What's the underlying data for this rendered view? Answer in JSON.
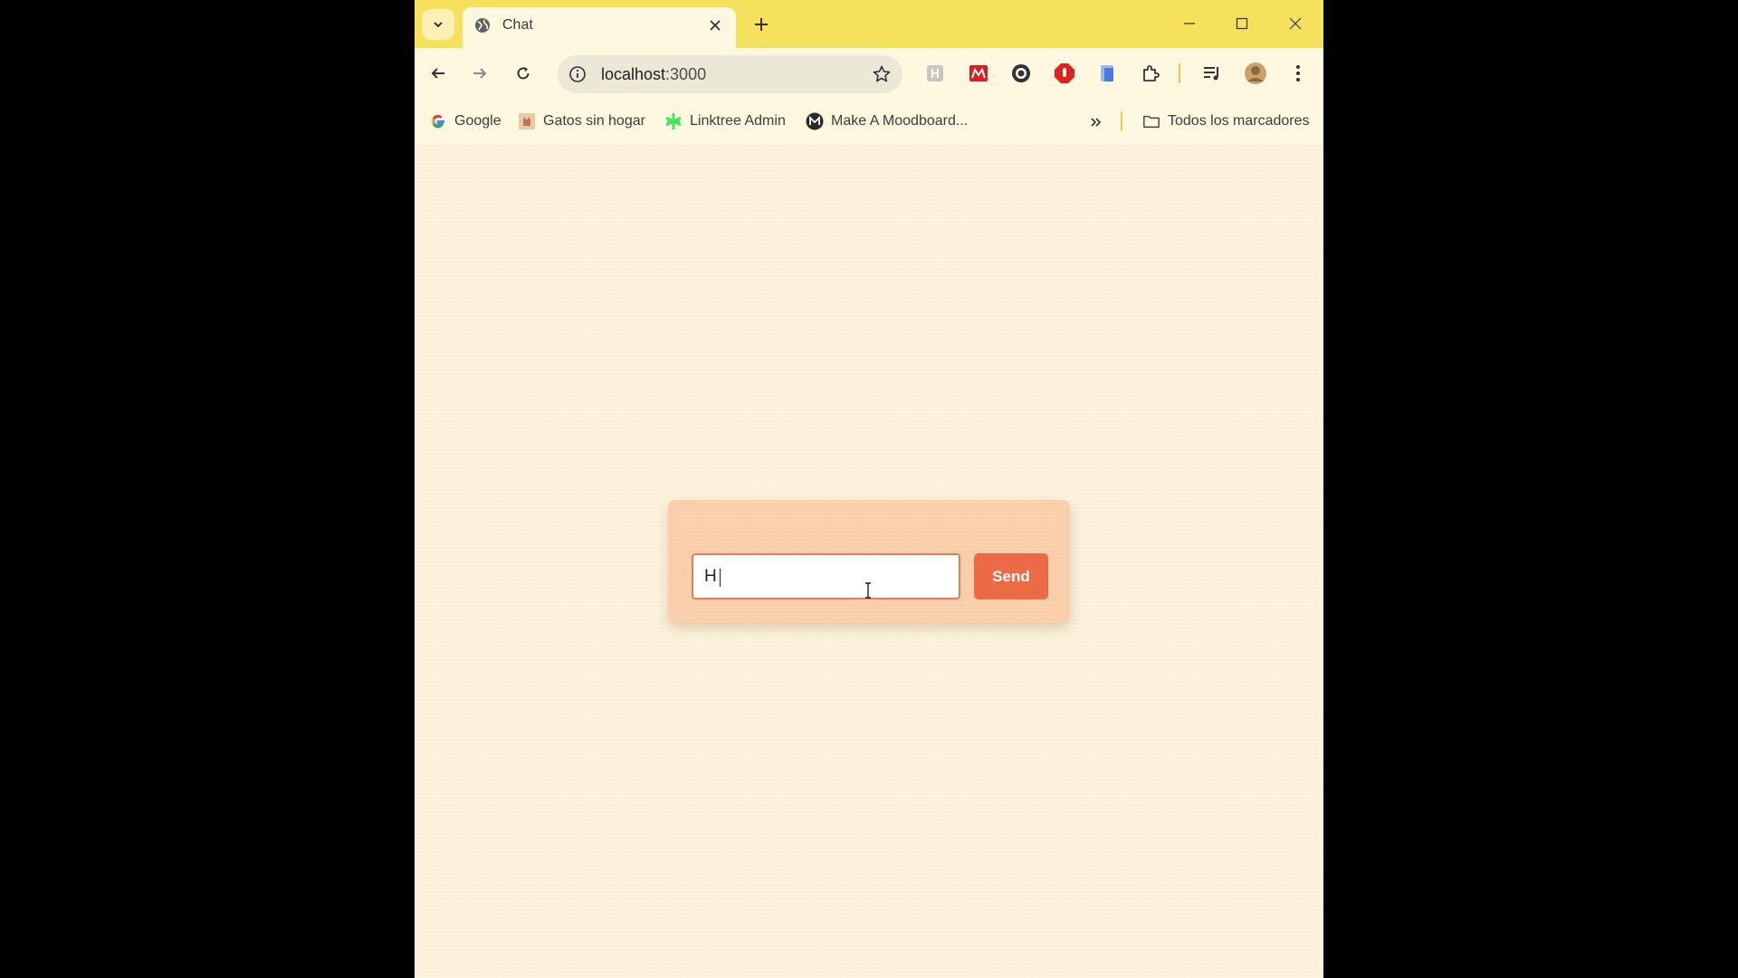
{
  "browser": {
    "tab": {
      "title": "Chat"
    },
    "address": {
      "host": "localhost",
      "port": ":3000"
    },
    "bookmarks": [
      {
        "label": "Google",
        "icon": "google-icon"
      },
      {
        "label": "Gatos sin hogar",
        "icon": "cat-icon"
      },
      {
        "label": "Linktree Admin",
        "icon": "linktree-icon"
      },
      {
        "label": "Make A Moodboard...",
        "icon": "moodboard-icon"
      }
    ],
    "all_bookmarks_label": "Todos los marcadores",
    "colors": {
      "titlebar": "#f5e15c",
      "toolbar": "#fdf8df"
    }
  },
  "chat": {
    "input_value": "H",
    "send_label": "Send",
    "colors": {
      "card": "#f8cda7",
      "send_button": "#ed6a46",
      "input_border": "#e8795b",
      "page_background": "#fdf3df"
    }
  }
}
